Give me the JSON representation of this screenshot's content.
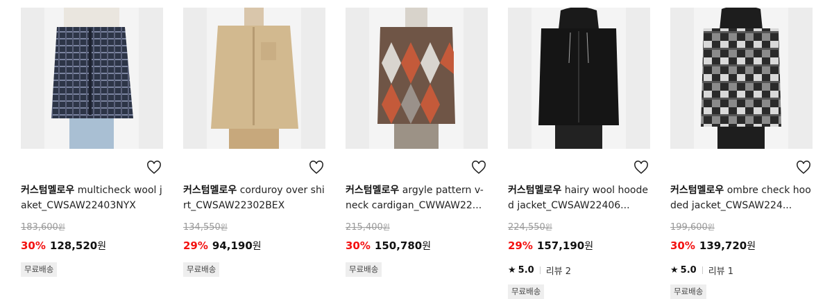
{
  "products": [
    {
      "brand": "커스텀멜로우",
      "name": "multicheck wool jaket_CWSAW22403NYX",
      "original_price": "183,600",
      "discount": "30%",
      "price": "128,520",
      "currency": "원",
      "rating": null,
      "badge": "무료배송"
    },
    {
      "brand": "커스텀멜로우",
      "name": "corduroy over shirt_CWSAW22302BEX",
      "original_price": "134,550",
      "discount": "29%",
      "price": "94,190",
      "currency": "원",
      "rating": null,
      "badge": "무료배송"
    },
    {
      "brand": "커스텀멜로우",
      "name": "argyle pattern v-neck cardigan_CWWAW22...",
      "original_price": "215,400",
      "discount": "30%",
      "price": "150,780",
      "currency": "원",
      "rating": null,
      "badge": "무료배송"
    },
    {
      "brand": "커스텀멜로우",
      "name": "hairy wool hooded jacket_CWSAW22406...",
      "original_price": "224,550",
      "discount": "29%",
      "price": "157,190",
      "currency": "원",
      "rating": {
        "score": "5.0",
        "reviews": "리뷰 2"
      },
      "badge": "무료배송"
    },
    {
      "brand": "커스텀멜로우",
      "name": "ombre check hooded jacket_CWSAW224...",
      "original_price": "199,600",
      "discount": "30%",
      "price": "139,720",
      "currency": "원",
      "rating": {
        "score": "5.0",
        "reviews": "리뷰 1"
      },
      "badge": "무료배송"
    }
  ],
  "icons": {
    "wishlist": "heart-outline-icon",
    "star": "star-icon"
  },
  "colors": {
    "discount": "#f31110",
    "badge_bg": "#eeeeee",
    "thumb_bg": "#ececec"
  }
}
